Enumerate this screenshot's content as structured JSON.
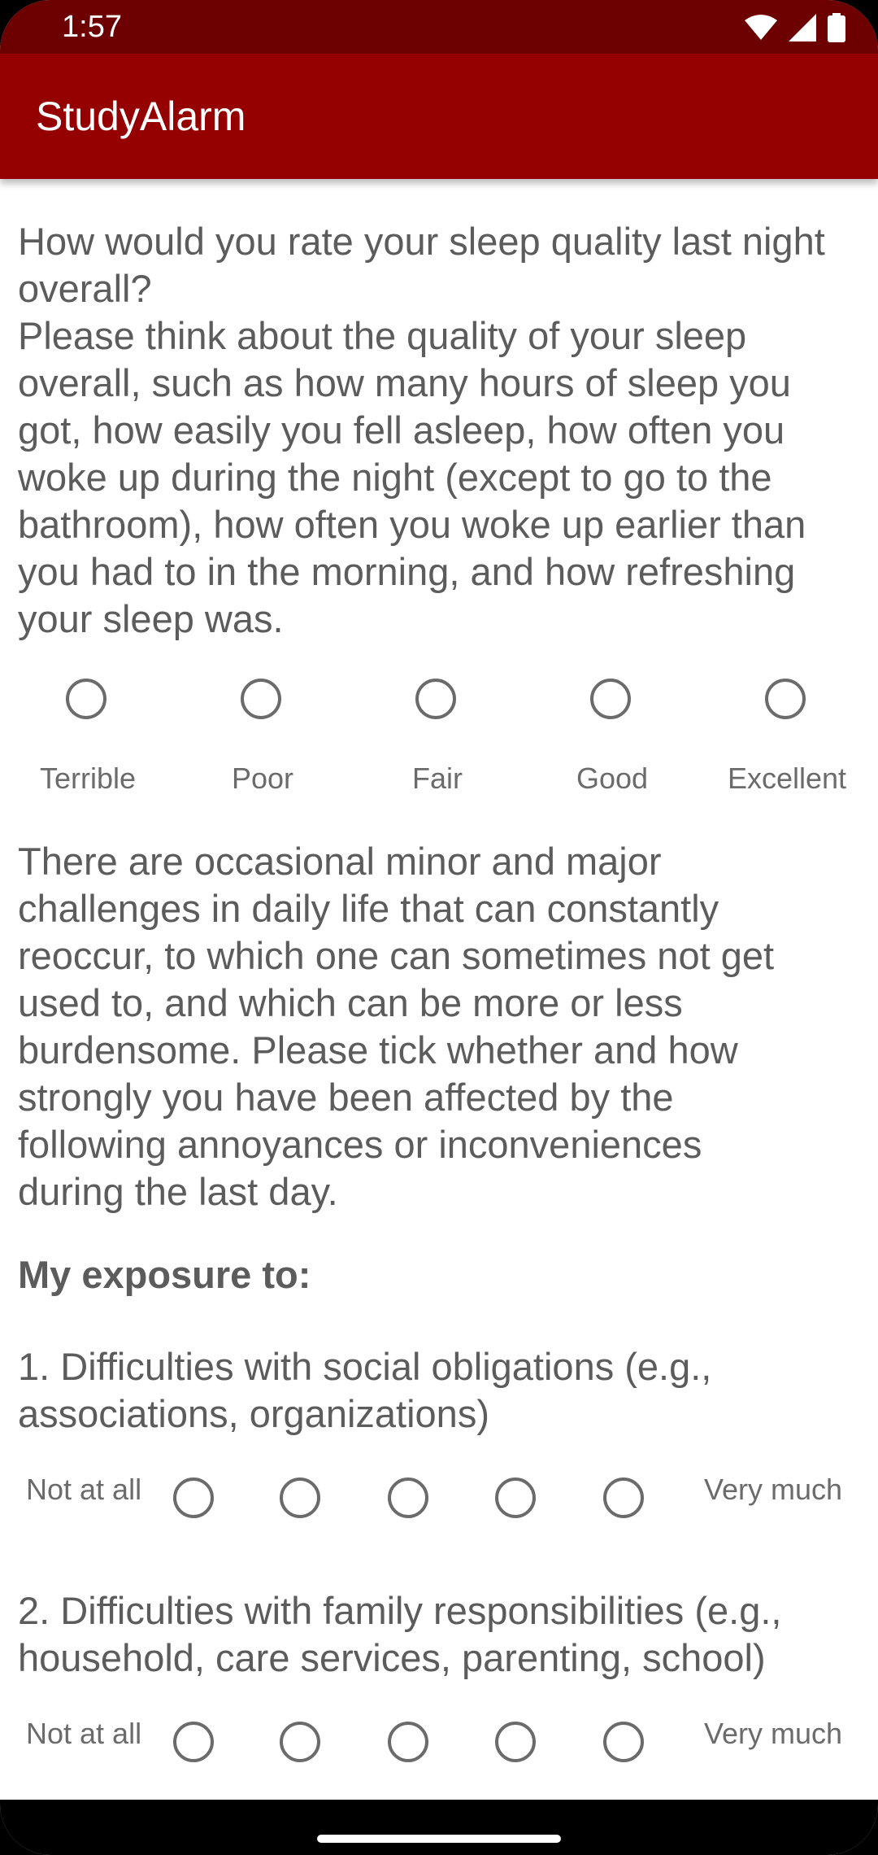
{
  "status_bar": {
    "time": "1:57"
  },
  "app_bar": {
    "title": "StudyAlarm"
  },
  "question1": {
    "text_line1": "How would you rate your sleep quality last night overall?",
    "text_rest": "Please think about the quality of your sleep overall, such as how many hours of sleep you got, how easily you fell asleep, how often you woke up during the night (except to go to the bathroom), how often you woke up earlier than you had to in the morning, and how refreshing your sleep was.",
    "options": [
      "Terrible",
      "Poor",
      "Fair",
      "Good",
      "Excellent"
    ]
  },
  "intro": {
    "text": "There are occasional minor and major challenges in daily life that can constantly reoccur, to which one can sometimes not get used to, and which can be more or less burdensome. Please tick whether and how strongly you have been affected by the following annoyances or inconveniences during the last day.",
    "heading": "My exposure to:"
  },
  "items": [
    {
      "text": "1. Difficulties with social obligations (e.g., associations, organizations)",
      "low_label": "Not at all",
      "high_label": "Very much"
    },
    {
      "text": "2. Difficulties with family responsibilities (e.g., household, care services, parenting, school)",
      "low_label": "Not at all",
      "high_label": "Very much"
    }
  ],
  "colors": {
    "status_bar": "#6d0000",
    "app_bar": "#950000",
    "text": "#5c5c5c"
  }
}
